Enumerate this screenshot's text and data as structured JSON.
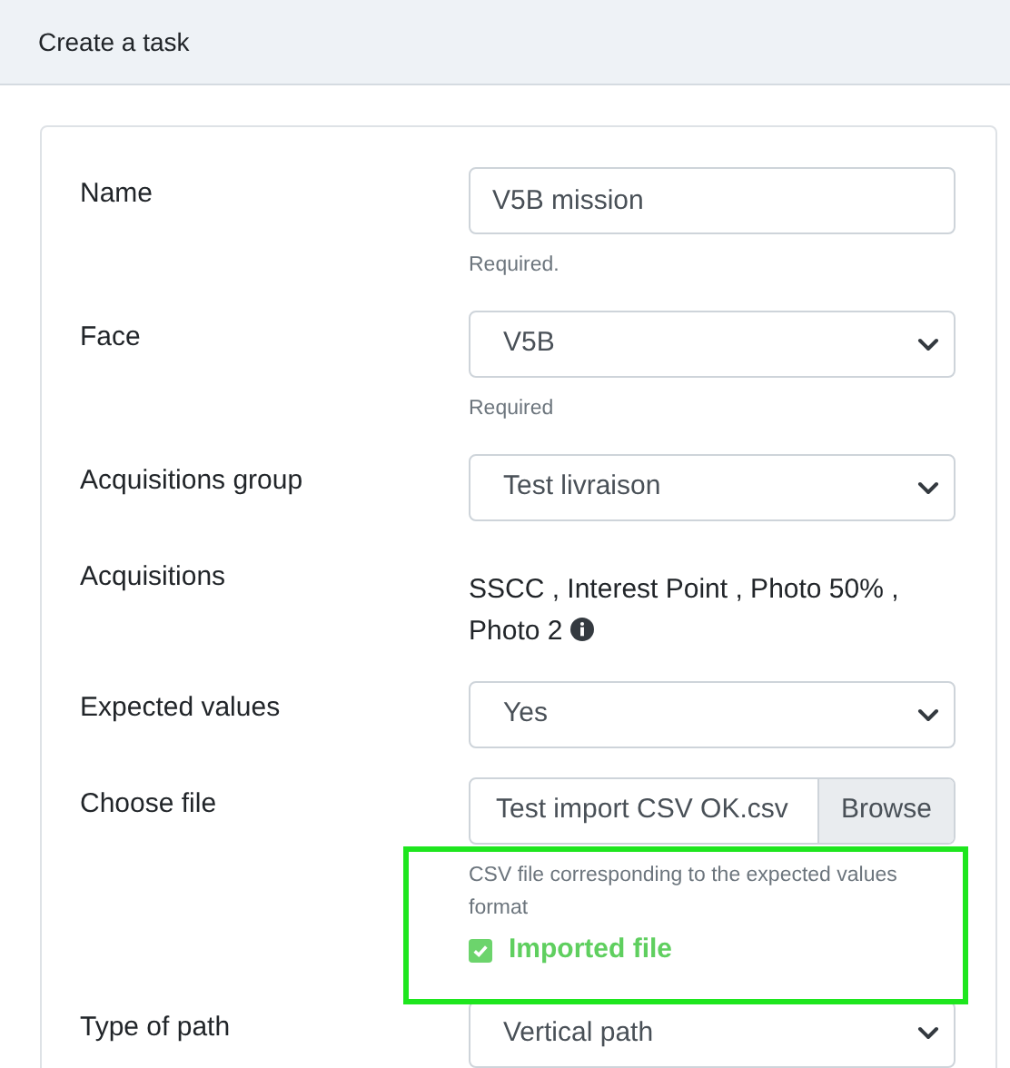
{
  "header": {
    "title": "Create a task"
  },
  "fields": [
    {
      "kind": "text",
      "label": "Name",
      "value": "V5B mission",
      "help": "Required."
    },
    {
      "kind": "select",
      "label": "Face",
      "value": "V5B",
      "help": "Required"
    },
    {
      "kind": "select",
      "label": "Acquisitions group",
      "value": "Test livraison"
    },
    {
      "kind": "info",
      "label": "Acquisitions",
      "value": "SSCC , Interest Point , Photo 50% , Photo 2"
    },
    {
      "kind": "select",
      "label": "Expected values",
      "value": "Yes"
    },
    {
      "kind": "file",
      "label": "Choose file",
      "value": "Test import CSV OK.csv",
      "button": "Browse",
      "help": "CSV file corresponding to the expected values format",
      "status": {
        "text": "Imported file",
        "checked": true
      },
      "highlighted": true
    },
    {
      "kind": "select",
      "label": "Type of path",
      "value": "Vertical path"
    }
  ]
}
